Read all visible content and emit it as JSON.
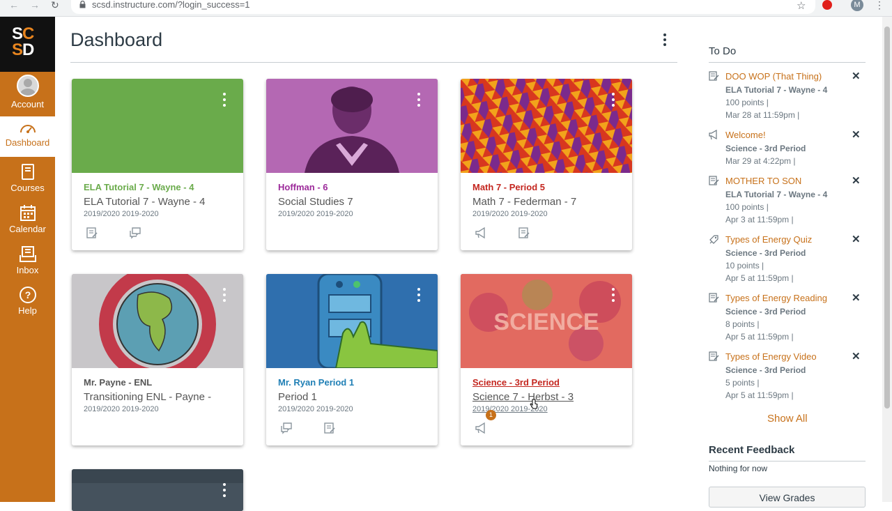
{
  "browser": {
    "url": "scsd.instructure.com/?login_success=1",
    "profile_initial": "M"
  },
  "logo": {
    "line1a": "S",
    "line1b": "C",
    "line2a": "S",
    "line2b": "D"
  },
  "global_nav": {
    "account": "Account",
    "dashboard": "Dashboard",
    "courses": "Courses",
    "calendar": "Calendar",
    "inbox": "Inbox",
    "help": "Help"
  },
  "header": {
    "title": "Dashboard"
  },
  "cards": [
    {
      "code": "ELA Tutorial 7 - Wayne - 4",
      "name": "ELA Tutorial 7 - Wayne - 4",
      "term": "2019/2020 2019-2020",
      "color": "#6aab4b"
    },
    {
      "code": "Hoffman - 6",
      "name": "Social Studies 7",
      "term": "2019/2020 2019-2020",
      "color": "#9c2a9a"
    },
    {
      "code": "Math 7 - Period 5",
      "name": "Math 7 - Federman - 7",
      "term": "2019/2020 2019-2020",
      "color": "#c4261f"
    },
    {
      "code": "Mr. Payne - ENL",
      "name": "Transitioning ENL - Payne -",
      "term": "2019/2020 2019-2020",
      "color": "#555555"
    },
    {
      "code": "Mr. Ryan Period 1",
      "name": "Period 1",
      "term": "2019/2020 2019-2020",
      "color": "#1f7fb5"
    },
    {
      "code": "Science - 3rd Period",
      "name": "Science 7 - Herbst - 3",
      "term": "2019/2020 2019-2020",
      "color": "#c4261f",
      "badge": "1"
    }
  ],
  "todo": {
    "heading": "To Do",
    "items": [
      {
        "title": "DOO WOP (That Thing)",
        "course": "ELA Tutorial 7 - Wayne - 4",
        "points": "100 points  |",
        "due": "Mar 28 at 11:59pm  |"
      },
      {
        "title": "Welcome!",
        "course": "Science - 3rd Period",
        "due": "Mar 29 at 4:22pm  |"
      },
      {
        "title": "MOTHER TO SON",
        "course": "ELA Tutorial 7 - Wayne - 4",
        "points": "100 points  |",
        "due": "Apr 3 at 11:59pm  |"
      },
      {
        "title": "Types of Energy Quiz",
        "course": "Science - 3rd Period",
        "points": "10 points  |",
        "due": "Apr 5 at 11:59pm  |"
      },
      {
        "title": "Types of Energy Reading",
        "course": "Science - 3rd Period",
        "points": "8 points  |",
        "due": "Apr 5 at 11:59pm  |"
      },
      {
        "title": "Types of Energy Video",
        "course": "Science - 3rd Period",
        "points": "5 points  |",
        "due": "Apr 5 at 11:59pm  |"
      }
    ],
    "show_all": "Show All"
  },
  "recent_feedback": {
    "heading": "Recent Feedback",
    "empty": "Nothing for now"
  },
  "view_grades": "View Grades",
  "colors": {
    "nav": "#c7711a",
    "accent": "#c7711a"
  }
}
